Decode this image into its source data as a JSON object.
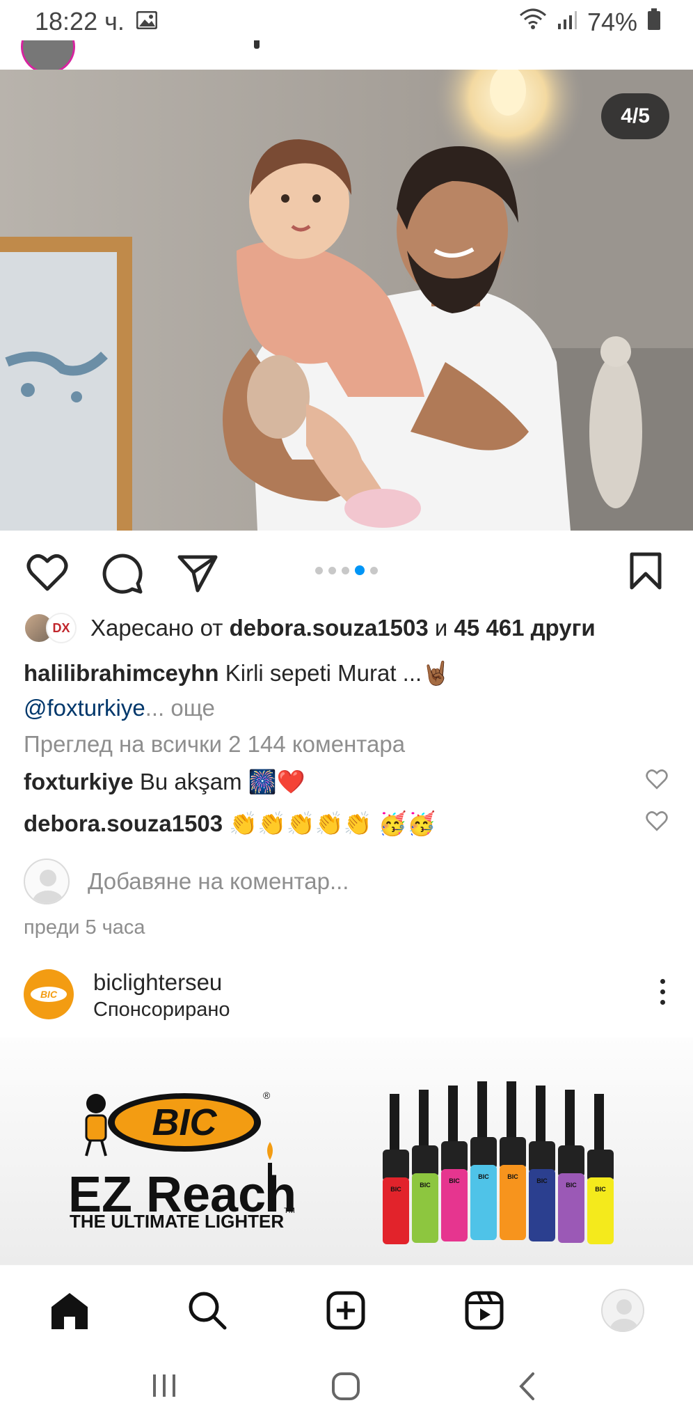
{
  "status_bar": {
    "time": "18:22 ч.",
    "battery": "74%"
  },
  "post": {
    "image_counter": "4/5",
    "carousel": {
      "total": 5,
      "active_index": 3
    },
    "liked_by_prefix": "Харесано от",
    "liked_by_user": "debora.souza1503",
    "liked_by_join": "и",
    "liked_by_others": "45 461 други",
    "liker_badge": "DX",
    "author": "halilibrahimceyhn",
    "caption_text": "Kirli sepeti Murat ...🤘🏾",
    "caption_mention": "@foxturkiye",
    "caption_ellipsis": "...",
    "caption_more": "още",
    "view_all_comments": "Преглед на всички 2 144 коментара",
    "comments": [
      {
        "user": "foxturkiye",
        "text": "Bu akşam 🎆❤️"
      },
      {
        "user": "debora.souza1503",
        "text": "👏👏👏👏👏 🥳🥳"
      }
    ],
    "add_comment_placeholder": "Добавяне на коментар...",
    "time_ago": "преди 5 часа"
  },
  "ad": {
    "account": "biclighterseu",
    "sponsored": "Спонсорирано",
    "avatar_text": "BIC",
    "brand": "BIC",
    "product": "EZ Reach",
    "tagline": "THE ULTIMATE LIGHTER",
    "trademark": "TM",
    "registered": "®",
    "lighter_label": "BIC",
    "lighter_colors": [
      "#e2232b",
      "#8dc63f",
      "#e6358f",
      "#4fc3e8",
      "#f7941d",
      "#2b3f8f",
      "#9b59b6",
      "#f4ea1c"
    ]
  },
  "colors": {
    "accent": "#0095f6",
    "link": "#00376b",
    "muted": "#8e8e8e",
    "bic_orange": "#f39c12"
  }
}
